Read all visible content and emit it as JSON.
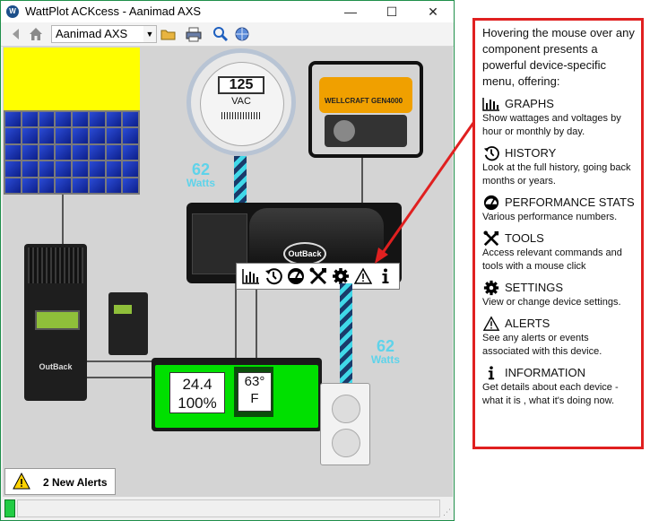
{
  "window": {
    "title": "WattPlot ACKcess - Aanimad AXS",
    "app_icon_text": "W",
    "controls": {
      "minimize": "—",
      "maximize": "☐",
      "close": "✕"
    }
  },
  "toolbar": {
    "site_select": "Aanimad AXS",
    "icons": [
      "back-icon",
      "home-icon",
      "open-folder-icon",
      "print-icon",
      "search-icon",
      "network-icon"
    ]
  },
  "diagram": {
    "meter": {
      "reading": "125",
      "unit": "VAC"
    },
    "meter_to_inverter": {
      "value": "62",
      "unit": "Watts"
    },
    "inverter_logo": "OutBack",
    "controller_logo": "OutBack",
    "generator_brand": "WELLCRAFT GEN4000",
    "battery": {
      "voltage": "24.4",
      "soc": "100%",
      "temperature": "63°",
      "temp_unit": "F"
    },
    "inverter_to_outlet": {
      "value": "62",
      "unit": "Watts"
    },
    "hover_menu": [
      "graphs-icon",
      "history-icon",
      "performance-icon",
      "tools-icon",
      "settings-icon",
      "alerts-icon",
      "information-icon"
    ]
  },
  "alerts": {
    "label": "2 New Alerts"
  },
  "callout": {
    "intro": "Hovering the mouse over any component presents a powerful device-specific menu, offering:",
    "features": [
      {
        "title": "GRAPHS",
        "desc": "Show wattages and voltages by hour or monthly by day.",
        "icon": "graphs-icon"
      },
      {
        "title": "HISTORY",
        "desc": "Look at the full history, going back months or years.",
        "icon": "history-icon"
      },
      {
        "title": "PERFORMANCE STATS",
        "desc": "Various performance numbers.",
        "icon": "performance-icon"
      },
      {
        "title": "TOOLS",
        "desc": "Access relevant commands and tools with a mouse click",
        "icon": "tools-icon"
      },
      {
        "title": "SETTINGS",
        "desc": "View or change device settings.",
        "icon": "settings-icon"
      },
      {
        "title": "ALERTS",
        "desc": "See any alerts or events associated with this device.",
        "icon": "alerts-icon"
      },
      {
        "title": "INFORMATION",
        "desc": "Get details about each device - what it is , what it's doing now.",
        "icon": "information-icon"
      }
    ]
  },
  "colors": {
    "accent_border": "#e02020",
    "canvas": "#d4d4d4",
    "watts_label": "#5fd3ea",
    "battery_green": "#00e000"
  }
}
